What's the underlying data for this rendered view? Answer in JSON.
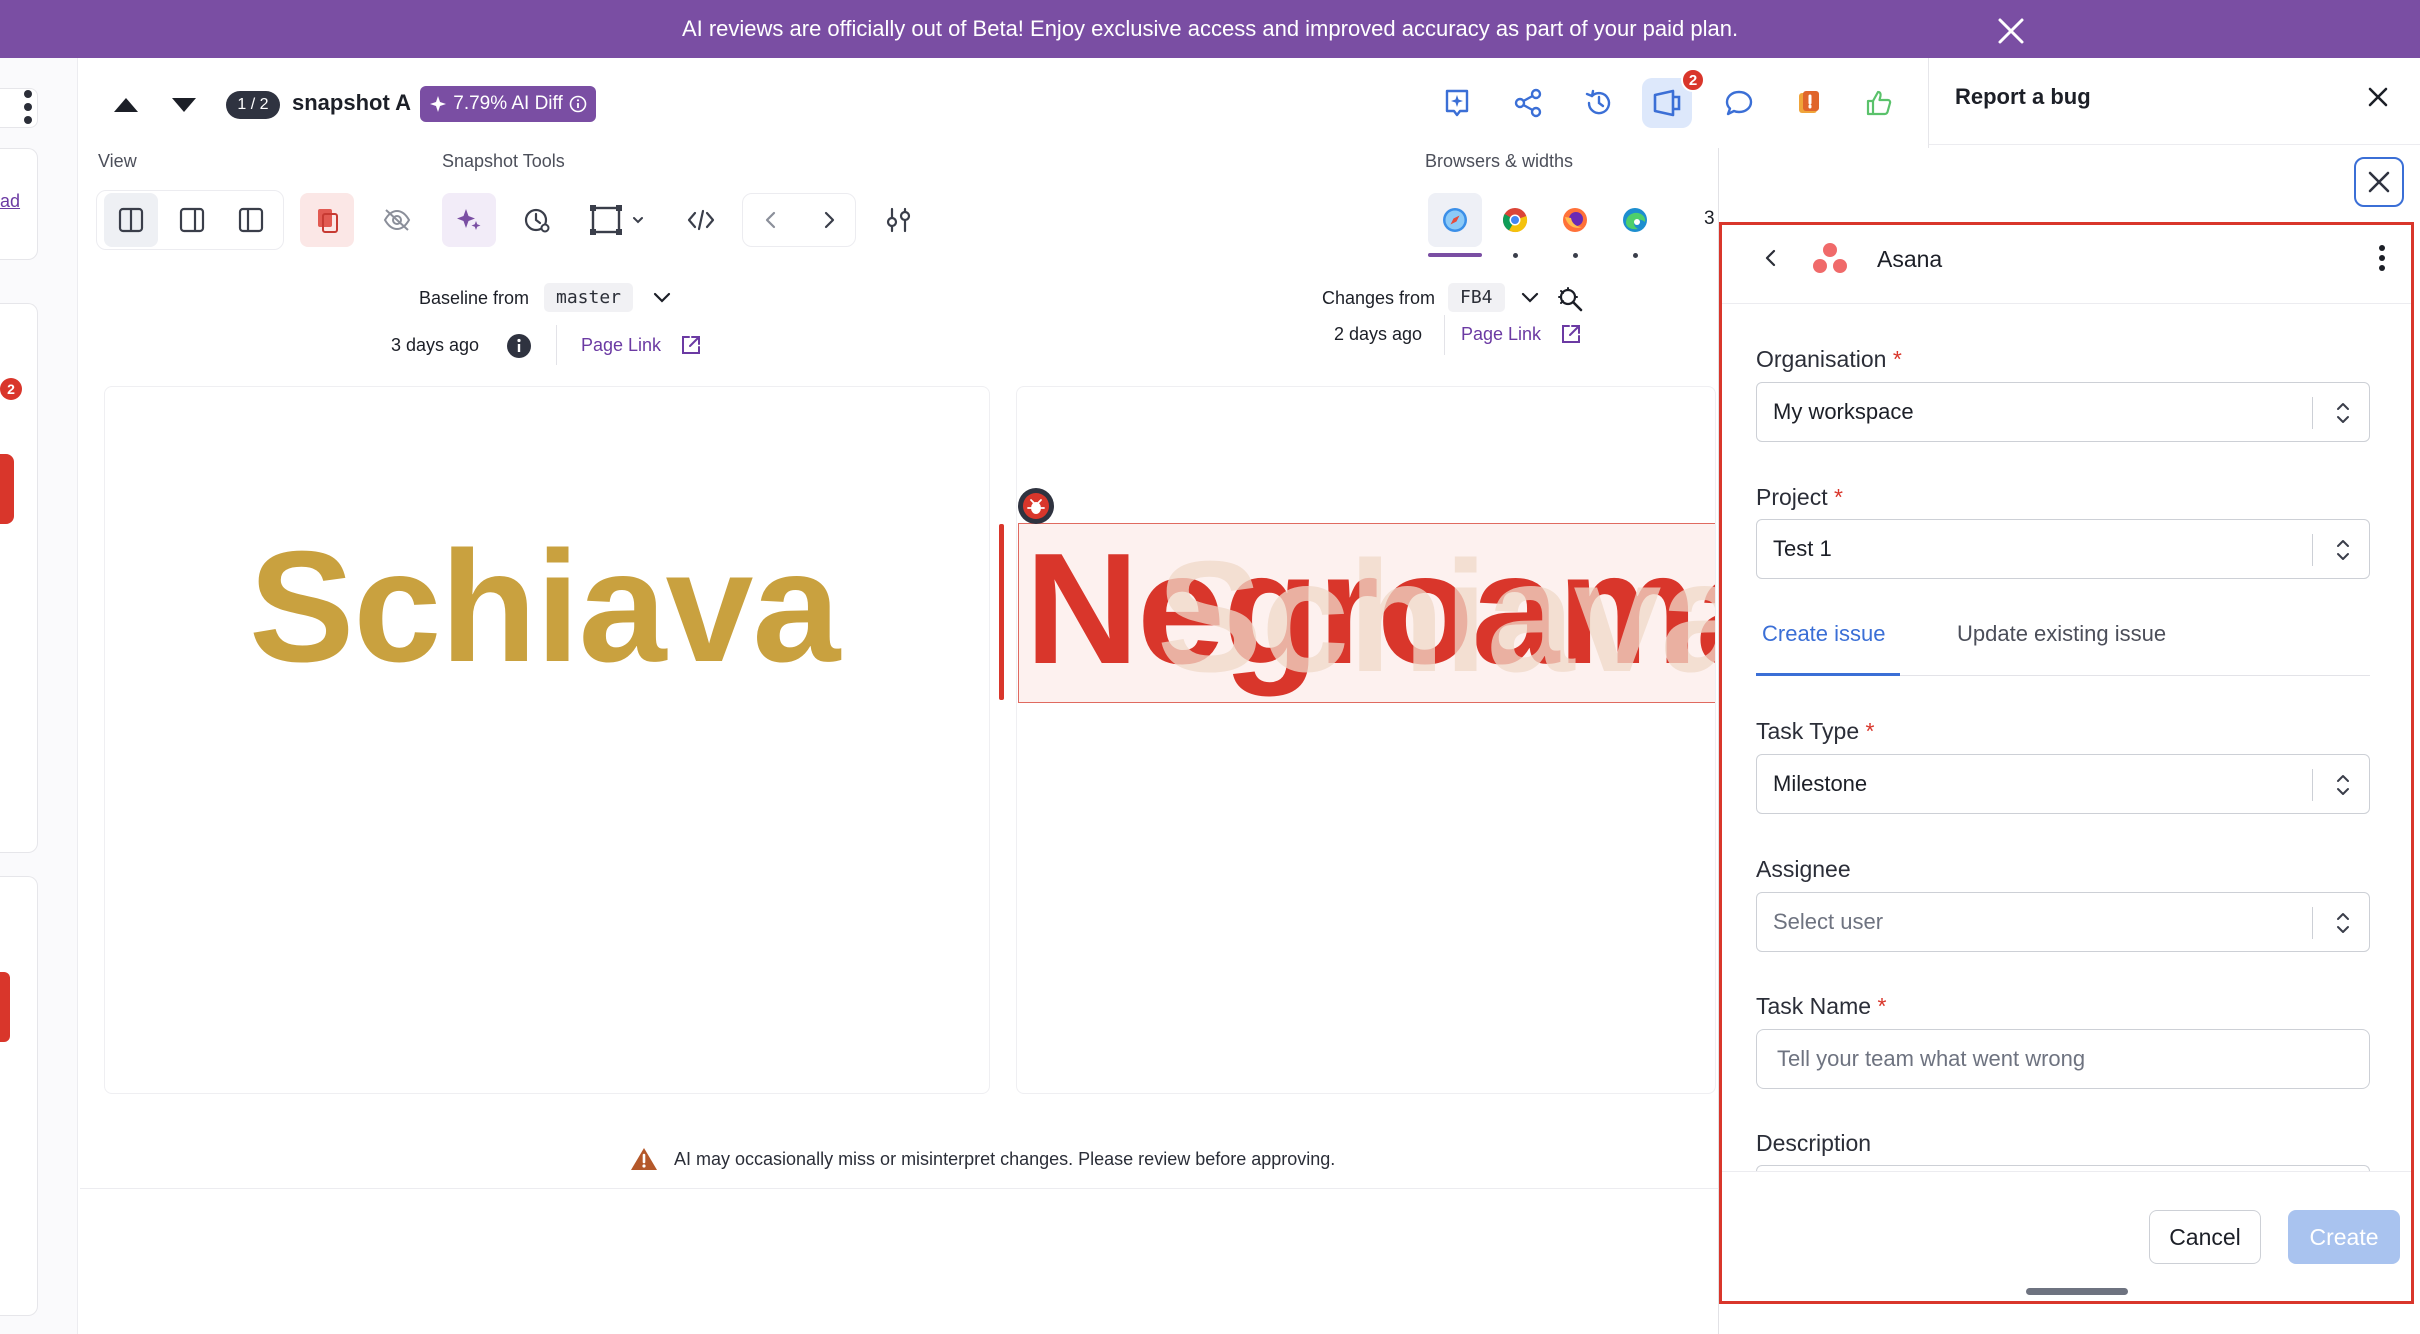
{
  "banner": {
    "text": "AI reviews are officially out of Beta! Enjoy exclusive access and improved accuracy as part of your paid plan."
  },
  "left_strip": {
    "link_text": "ad",
    "badge_count": "2"
  },
  "header": {
    "counter": "1 / 2",
    "snapshot_name": "snapshot A",
    "ai_diff": "7.79% AI Diff",
    "notification_count": "2"
  },
  "toolbar": {
    "view_label": "View",
    "snapshot_tools_label": "Snapshot Tools",
    "browsers_label": "Browsers & widths",
    "width_count": "3"
  },
  "baseline": {
    "label": "Baseline from",
    "branch": "master",
    "age": "3 days ago",
    "page_link": "Page Link"
  },
  "changes": {
    "label": "Changes from",
    "branch": "FB4",
    "age": "2 days ago",
    "page_link": "Page Link"
  },
  "canvas": {
    "baseline_word": "Schiava",
    "changed_word_new": "Negroamaro",
    "changed_word_old": "Schiava",
    "baseline_color": "#c9a13f",
    "diff_color": "#d9362b"
  },
  "ai_notice": "AI may occasionally miss or misinterpret changes. Please review before approving.",
  "report_panel": {
    "title": "Report a bug"
  },
  "integration": {
    "name": "Asana"
  },
  "form": {
    "organisation_label": "Organisation",
    "organisation_value": "My workspace",
    "project_label": "Project",
    "project_value": "Test 1",
    "tabs": [
      "Create issue",
      "Update existing issue"
    ],
    "active_tab": "Create issue",
    "task_type_label": "Task Type",
    "task_type_value": "Milestone",
    "assignee_label": "Assignee",
    "assignee_placeholder": "Select user",
    "task_name_label": "Task Name",
    "task_name_placeholder": "Tell your team what went wrong",
    "description_label": "Description",
    "required_mark": "*",
    "cancel_label": "Cancel",
    "create_label": "Create"
  },
  "colors": {
    "brand_purple": "#7a4ea3",
    "accent_blue": "#3b6fd6",
    "error_red": "#d9362b"
  }
}
